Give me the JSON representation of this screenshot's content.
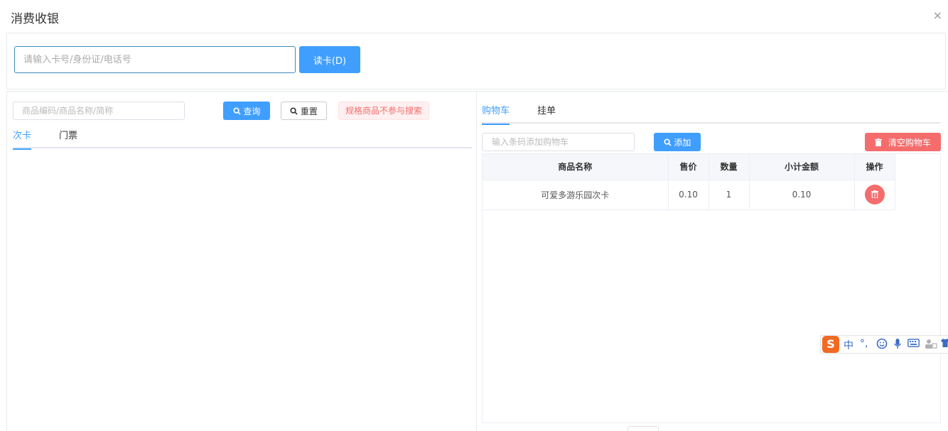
{
  "dialog": {
    "title": "消费收银",
    "close_label": "×"
  },
  "readcard": {
    "placeholder": "请输入卡号/身份证/电话号",
    "button_label": "读卡(D)"
  },
  "goods_search": {
    "placeholder": "商品编码/商品名称/简称",
    "query_label": "查询",
    "reset_label": "重置",
    "hint": "规格商品不参与搜索",
    "tabs": [
      "次卡",
      "门票"
    ]
  },
  "cart": {
    "tabs": [
      "购物车",
      "挂单"
    ],
    "barcode_placeholder": "输入条码添加购物车",
    "add_label": "添加",
    "clear_label": "清空购物车",
    "columns": [
      "商品名称",
      "售价",
      "数量",
      "小计金额",
      "操作"
    ],
    "rows": [
      {
        "name": "可爱多游乐园次卡",
        "price": "0.10",
        "qty": "1",
        "subtotal": "0.10"
      }
    ]
  },
  "ime": {
    "logo": "S",
    "mode": "中",
    "punct": "°,"
  },
  "icons": {
    "close": "close-icon",
    "search": "search-icon",
    "trash": "trash-icon"
  },
  "colors": {
    "primary": "#409eff",
    "danger": "#f56c6c"
  }
}
